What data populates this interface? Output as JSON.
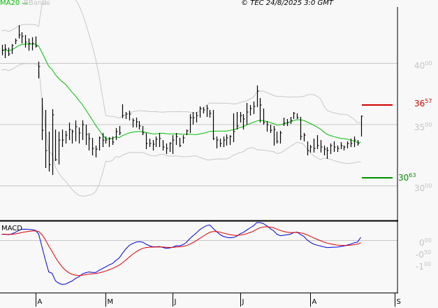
{
  "legend": {
    "ma": "MA20",
    "bbands": "BBands",
    "macd": "MACD"
  },
  "copyright": "© TEC 24/8/2025 3:0 GMT",
  "colors": {
    "ma": "#00c000",
    "bbands": "#c8c8c8",
    "bars": "#000000",
    "macd": "#0000e0",
    "signal": "#e00000",
    "resistance": "#d00000",
    "support": "#009000",
    "grid": "#c8c8c8"
  },
  "levels": {
    "resistance": {
      "value": 36.57,
      "int": "36",
      "dec": "57"
    },
    "support": {
      "value": 30.63,
      "int": "30",
      "dec": "63"
    }
  },
  "chart_data": {
    "type": "ohlc",
    "price_axis": [
      {
        "value": 40,
        "int": "40",
        "dec": "00"
      },
      {
        "value": 35,
        "int": "35",
        "dec": "00"
      },
      {
        "value": 30,
        "int": "30",
        "dec": "00"
      }
    ],
    "price_range": [
      27.2,
      45.15
    ],
    "macd_axis": [
      {
        "value": 0,
        "int": "0",
        "dec": "00"
      },
      {
        "value": -0.5,
        "int": "-0",
        "dec": "50"
      },
      {
        "value": -1,
        "int": "-1",
        "dec": "00"
      }
    ],
    "macd_range": [
      -2.15,
      0.85
    ],
    "months": [
      "A",
      "M",
      "J",
      "J",
      "A",
      "S"
    ],
    "month_bar_index": [
      10,
      31,
      51,
      71,
      92,
      117
    ],
    "indicators": {
      "ma_period": 20,
      "bb_stddev": 2,
      "macd": [
        12,
        26,
        9
      ]
    },
    "bars_hlc": [
      [
        41.49,
        40.63,
        41.03
      ],
      [
        41.54,
        40.4,
        41.14
      ],
      [
        41.26,
        40.57,
        40.74
      ],
      [
        41.54,
        40.74,
        41.43
      ],
      [
        42.0,
        41.54,
        41.83
      ],
      [
        43.09,
        42.0,
        42.29
      ],
      [
        42.51,
        41.6,
        42.17
      ],
      [
        42.29,
        41.26,
        41.71
      ],
      [
        42.0,
        41.0,
        41.6
      ],
      [
        42.1,
        41.03,
        41.6
      ],
      [
        42.17,
        41.26,
        41.37
      ],
      [
        40.11,
        38.74,
        39.71
      ],
      [
        37.14,
        33.71,
        34.51
      ],
      [
        36.17,
        31.43,
        32.86
      ],
      [
        34.4,
        31.14,
        31.71
      ],
      [
        36.23,
        30.86,
        35.77
      ],
      [
        34.57,
        32.0,
        32.11
      ],
      [
        34.4,
        31.71,
        33.71
      ],
      [
        34.57,
        33.14,
        33.71
      ],
      [
        34.46,
        33.43,
        34.11
      ],
      [
        35.14,
        33.71,
        34.57
      ],
      [
        34.57,
        33.43,
        34.4
      ],
      [
        35.31,
        33.6,
        34.8
      ],
      [
        34.74,
        33.43,
        34.29
      ],
      [
        35.31,
        33.71,
        34.97
      ],
      [
        34.97,
        33.31,
        34.17
      ],
      [
        34.29,
        32.86,
        33.83
      ],
      [
        33.89,
        32.46,
        33.03
      ],
      [
        33.26,
        32.29,
        32.97
      ],
      [
        34.0,
        32.86,
        33.89
      ],
      [
        34.29,
        33.14,
        33.71
      ],
      [
        34.0,
        33.43,
        33.71
      ],
      [
        33.94,
        33.14,
        33.83
      ],
      [
        34.0,
        33.31,
        33.54
      ],
      [
        34.69,
        33.71,
        34.4
      ],
      [
        34.86,
        34.11,
        34.29
      ],
      [
        36.63,
        35.49,
        35.71
      ],
      [
        36.0,
        35.43,
        35.83
      ],
      [
        36.11,
        35.31,
        35.83
      ],
      [
        35.49,
        34.74,
        35.31
      ],
      [
        35.54,
        34.74,
        35.2
      ],
      [
        35.26,
        34.57,
        34.86
      ],
      [
        34.86,
        34.11,
        34.29
      ],
      [
        34.29,
        32.97,
        33.43
      ],
      [
        33.83,
        33.14,
        33.43
      ],
      [
        33.71,
        32.86,
        33.37
      ],
      [
        34.0,
        33.14,
        33.77
      ],
      [
        34.29,
        33.14,
        33.83
      ],
      [
        33.71,
        32.86,
        33.14
      ],
      [
        33.43,
        32.57,
        33.03
      ],
      [
        33.54,
        32.74,
        33.43
      ],
      [
        34.11,
        32.57,
        33.71
      ],
      [
        34.29,
        33.31,
        34.0
      ],
      [
        33.89,
        33.14,
        33.26
      ],
      [
        34.11,
        33.43,
        33.89
      ],
      [
        34.57,
        34.11,
        34.46
      ],
      [
        35.83,
        34.29,
        35.54
      ],
      [
        36.0,
        34.97,
        35.54
      ],
      [
        36.0,
        35.14,
        35.71
      ],
      [
        36.46,
        35.54,
        36.29
      ],
      [
        36.4,
        35.89,
        36.17
      ],
      [
        36.57,
        35.6,
        36.29
      ],
      [
        36.17,
        35.54,
        35.89
      ],
      [
        36.17,
        33.71,
        33.83
      ],
      [
        34.0,
        33.03,
        33.71
      ],
      [
        33.83,
        33.14,
        33.43
      ],
      [
        34.0,
        33.14,
        33.71
      ],
      [
        34.17,
        33.26,
        33.89
      ],
      [
        34.11,
        33.31,
        34.0
      ],
      [
        35.89,
        33.54,
        34.4
      ],
      [
        36.0,
        34.57,
        34.86
      ],
      [
        36.0,
        35.14,
        35.71
      ],
      [
        35.83,
        34.57,
        35.43
      ],
      [
        36.74,
        34.97,
        36.0
      ],
      [
        36.57,
        35.71,
        36.29
      ],
      [
        36.86,
        35.83,
        36.46
      ],
      [
        38.17,
        36.4,
        37.71
      ],
      [
        37.14,
        35.14,
        36.57
      ],
      [
        36.29,
        34.97,
        35.14
      ],
      [
        35.26,
        34.4,
        34.97
      ],
      [
        34.97,
        34.29,
        34.51
      ],
      [
        34.86,
        33.26,
        34.57
      ],
      [
        34.4,
        33.43,
        33.6
      ],
      [
        34.46,
        33.43,
        34.29
      ],
      [
        35.54,
        34.86,
        35.09
      ],
      [
        35.43,
        34.86,
        35.14
      ],
      [
        35.6,
        35.03,
        35.31
      ],
      [
        36.0,
        35.43,
        35.89
      ],
      [
        35.89,
        35.43,
        35.54
      ],
      [
        35.6,
        33.71,
        34.0
      ],
      [
        34.29,
        33.6,
        34.11
      ],
      [
        33.6,
        32.46,
        32.86
      ],
      [
        33.31,
        32.69,
        33.14
      ],
      [
        33.83,
        32.69,
        33.03
      ],
      [
        34.11,
        32.97,
        33.26
      ],
      [
        33.71,
        32.69,
        33.14
      ],
      [
        33.26,
        32.46,
        32.97
      ],
      [
        33.14,
        32.17,
        32.86
      ],
      [
        33.43,
        32.57,
        33.26
      ],
      [
        33.6,
        32.74,
        33.14
      ],
      [
        33.26,
        32.74,
        33.03
      ],
      [
        33.54,
        32.97,
        33.26
      ],
      [
        33.26,
        32.86,
        33.14
      ],
      [
        33.6,
        33.03,
        33.43
      ],
      [
        33.83,
        33.14,
        33.43
      ],
      [
        34.0,
        33.14,
        33.71
      ],
      [
        33.71,
        33.26,
        33.43
      ],
      [
        35.71,
        34.0,
        35.66
      ]
    ]
  }
}
